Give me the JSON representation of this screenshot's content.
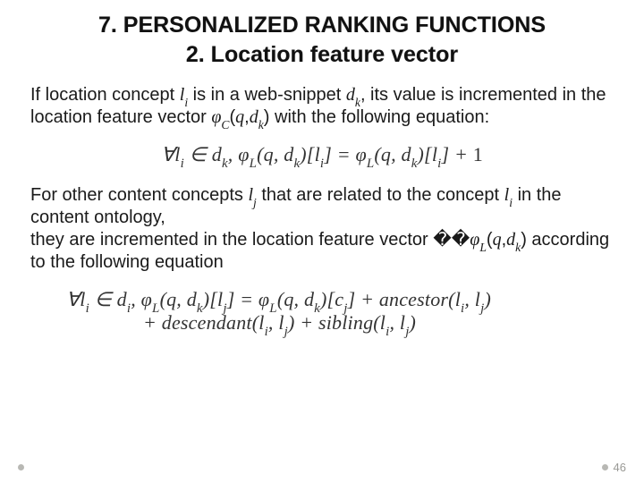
{
  "heading": {
    "title": "7. PERSONALIZED RANKING FUNCTIONS",
    "subtitle": "2. Location feature vector"
  },
  "body": {
    "para1_a": "If location concept ",
    "para1_var1": "l",
    "para1_sub1": "i",
    "para1_b": " is in a web-snippet ",
    "para1_var2": "d",
    "para1_sub2": "k",
    "para1_c": ", its value is incremented in the location feature vector ",
    "para1_var3": "φ",
    "para1_sub3": "C",
    "para1_d": "(",
    "para1_var4": "q",
    "para1_e": ",",
    "para1_var5": "d",
    "para1_sub5": "k",
    "para1_f": ") with the following equation:",
    "eq1": "∀l<sub>i</sub> ∈ d<sub>k</sub>,  φ<sub>L</sub>(q, d<sub>k</sub>)[l<sub>i</sub>] = φ<sub>L</sub>(q, d<sub>k</sub>)[l<sub>i</sub>] + <span class=\"up\">1</span>",
    "para2_a": "For other content concepts ",
    "para2_var1": "l",
    "para2_sub1": "j",
    "para2_b": " that are related to the concept ",
    "para2_var2": "l",
    "para2_sub2": "i",
    "para2_c": " in the content ontology,",
    "para2_d": "they are incremented in the location feature vector ��",
    "para2_var3": "φ",
    "para2_sub3": "L",
    "para2_e": "(",
    "para2_var4": "q",
    "para2_f": ",",
    "para2_var5": "d",
    "para2_sub5": "k",
    "para2_g": ") according to the following equation",
    "eq2_line1": "∀l<sub>i</sub> ∈ d<sub>i</sub>,  φ<sub>L</sub>(q, d<sub>k</sub>)[l<sub>j</sub>] = φ<sub>L</sub>(q, d<sub>k</sub>)[c<sub>j</sub>] + ancestor(l<sub>i</sub>, l<sub>j</sub>)",
    "eq2_line2": "+ descendant(l<sub>i</sub>, l<sub>j</sub>) + sibling(l<sub>i</sub>, l<sub>j</sub>)"
  },
  "footer": {
    "page": "46"
  }
}
